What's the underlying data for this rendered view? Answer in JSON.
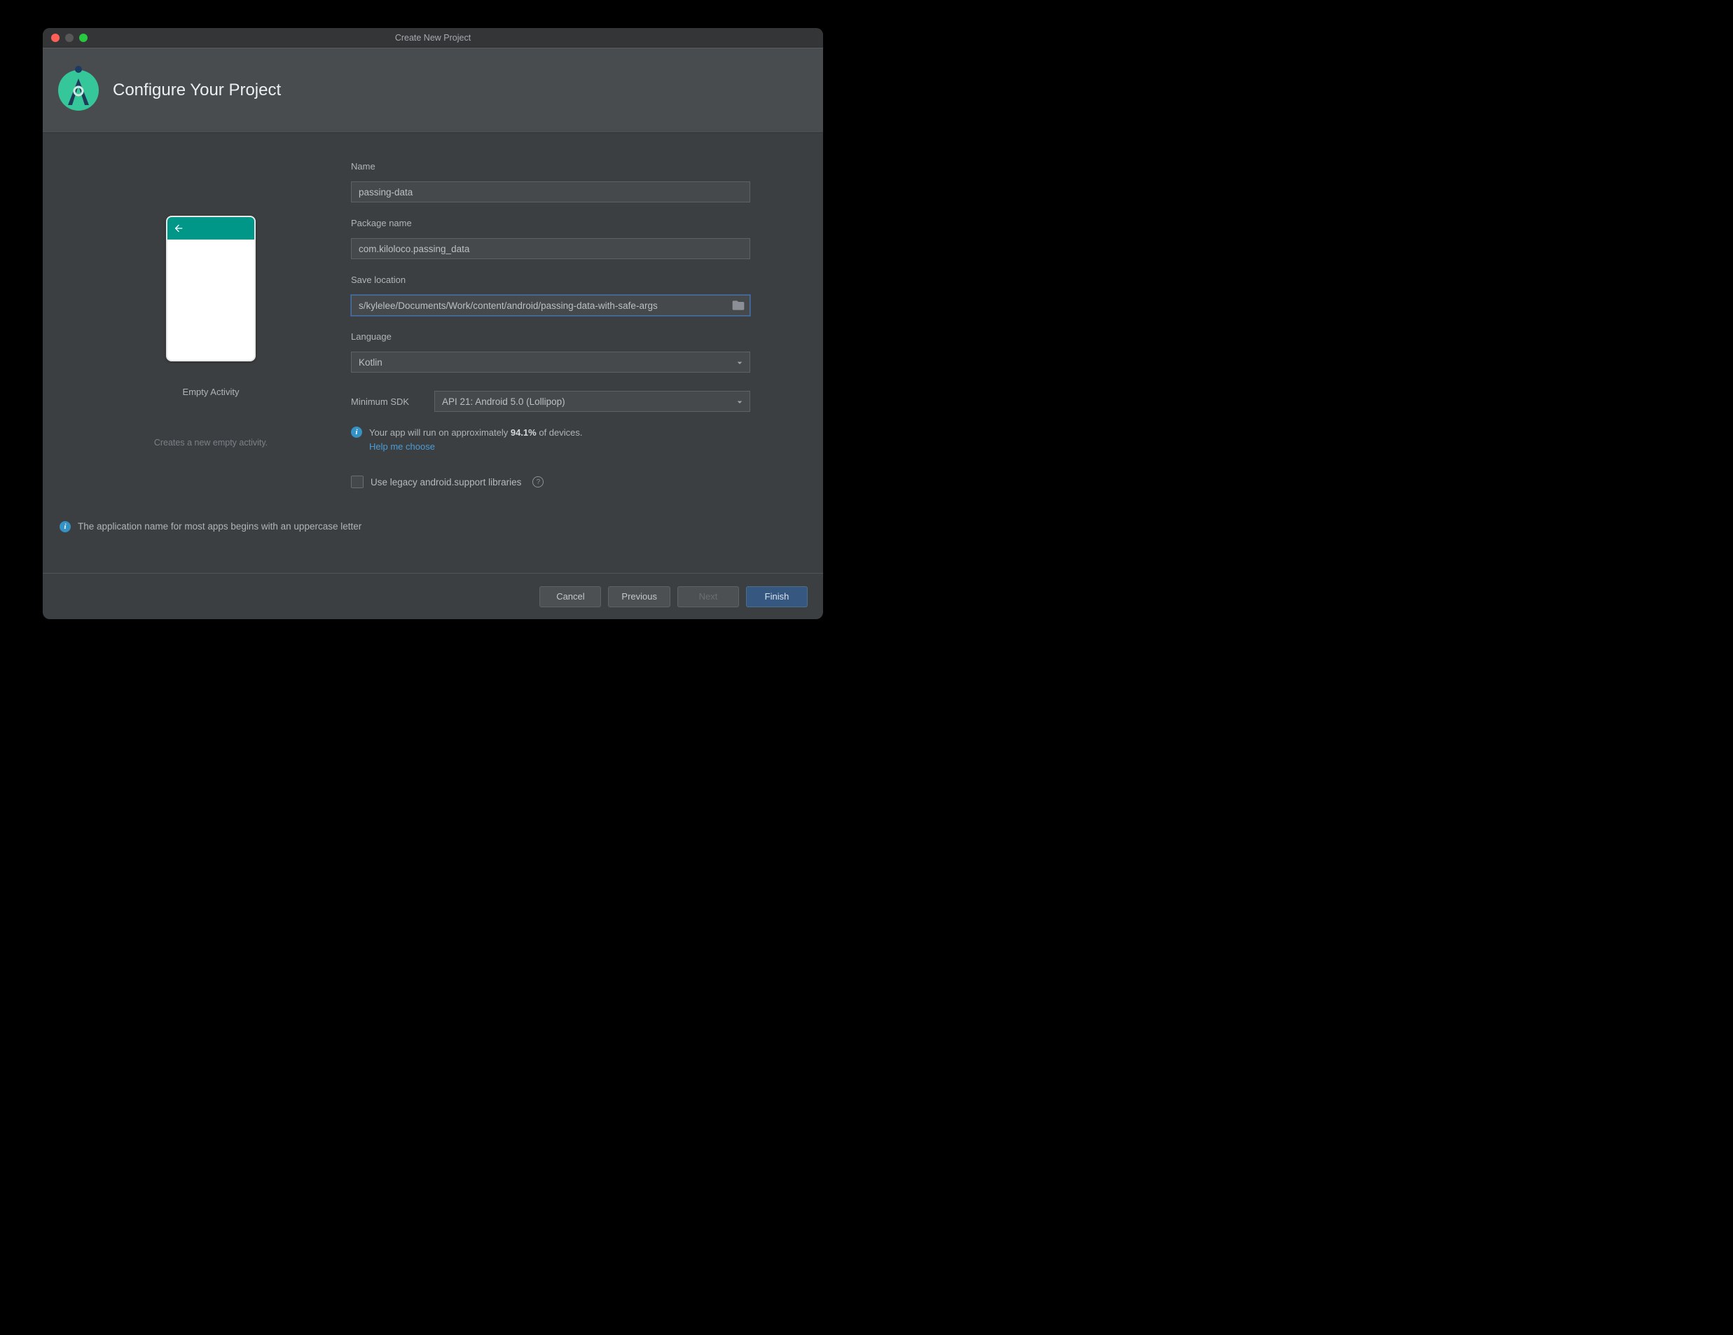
{
  "window": {
    "title": "Create New Project"
  },
  "header": {
    "page_title": "Configure Your Project"
  },
  "preview": {
    "template_name": "Empty Activity",
    "template_desc": "Creates a new empty activity."
  },
  "form": {
    "name_label": "Name",
    "name_value": "passing-data",
    "package_label": "Package name",
    "package_value": "com.kiloloco.passing_data",
    "location_label": "Save location",
    "location_value": "s/kylelee/Documents/Work/content/android/passing-data-with-safe-args",
    "language_label": "Language",
    "language_value": "Kotlin",
    "min_sdk_label": "Minimum SDK",
    "min_sdk_value": "API 21: Android 5.0 (Lollipop)",
    "sdk_info_a": "Your app will run on approximately ",
    "sdk_info_pct": "94.1%",
    "sdk_info_b": " of devices.",
    "sdk_help_link": "Help me choose",
    "legacy_label": "Use legacy android.support libraries"
  },
  "footnote": "The application name for most apps begins with an uppercase letter",
  "buttons": {
    "cancel": "Cancel",
    "previous": "Previous",
    "next": "Next",
    "finish": "Finish"
  }
}
